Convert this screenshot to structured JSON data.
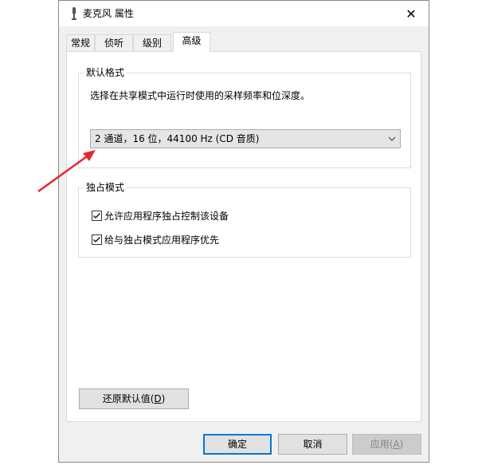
{
  "window": {
    "title": "麦克风 属性",
    "close_label": "✕"
  },
  "tabs": [
    {
      "label": "常规"
    },
    {
      "label": "侦听"
    },
    {
      "label": "级别"
    },
    {
      "label": "高级"
    }
  ],
  "default_format": {
    "legend": "默认格式",
    "description": "选择在共享模式中运行时使用的采样频率和位深度。",
    "selected_value": "2 通道，16 位，44100 Hz (CD 音质)"
  },
  "exclusive_mode": {
    "legend": "独占模式",
    "options": [
      {
        "label": "允许应用程序独占控制该设备",
        "checked": true
      },
      {
        "label": "给与独占模式应用程序优先",
        "checked": true
      }
    ]
  },
  "restore_defaults": {
    "label_prefix": "还原默认值(",
    "mnemonic": "D",
    "label_suffix": ")"
  },
  "footer": {
    "ok_label": "确定",
    "cancel_label": "取消",
    "apply_prefix": "应用(",
    "apply_mnemonic": "A",
    "apply_suffix": ")"
  },
  "annotation": {
    "arrow_color": "#e8262c"
  }
}
